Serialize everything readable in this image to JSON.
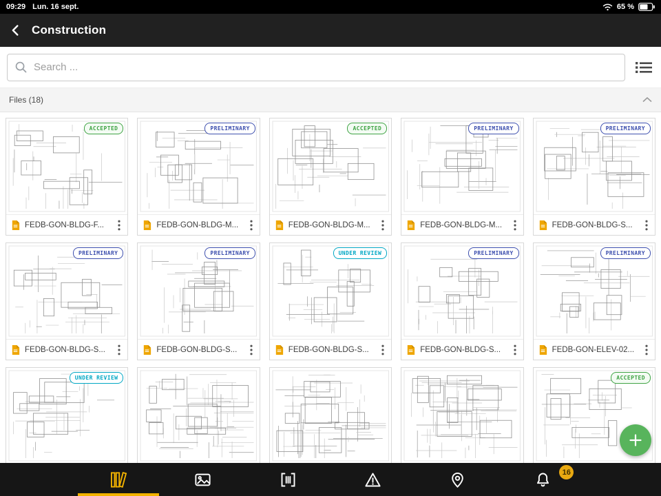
{
  "status_bar": {
    "time": "09:29",
    "date": "Lun. 16 sept.",
    "battery_percent": "65 %"
  },
  "header": {
    "title": "Construction"
  },
  "search": {
    "placeholder": "Search ..."
  },
  "files_section": {
    "title": "Files (18)"
  },
  "colors": {
    "accent": "#f2b200",
    "fab": "#58b45c",
    "accepted": "#3fa344",
    "preliminary": "#3d4fae",
    "under_review": "#00a7c4"
  },
  "statuses": {
    "ACCEPTED": {
      "color": "#3fa344",
      "bg": "#f3fbf3"
    },
    "PRELIMINARY": {
      "color": "#3d4fae",
      "bg": "#ffffff"
    },
    "UNDER REVIEW": {
      "color": "#00a7c4",
      "bg": "#ffffff"
    }
  },
  "files": [
    {
      "name": "FEDB-GON-BLDG-F...",
      "status": "ACCEPTED"
    },
    {
      "name": "FEDB-GON-BLDG-M...",
      "status": "PRELIMINARY"
    },
    {
      "name": "FEDB-GON-BLDG-M...",
      "status": "ACCEPTED"
    },
    {
      "name": "FEDB-GON-BLDG-M...",
      "status": "PRELIMINARY"
    },
    {
      "name": "FEDB-GON-BLDG-S...",
      "status": "PRELIMINARY"
    },
    {
      "name": "FEDB-GON-BLDG-S...",
      "status": "PRELIMINARY"
    },
    {
      "name": "FEDB-GON-BLDG-S...",
      "status": "PRELIMINARY"
    },
    {
      "name": "FEDB-GON-BLDG-S...",
      "status": "UNDER REVIEW"
    },
    {
      "name": "FEDB-GON-BLDG-S...",
      "status": "PRELIMINARY"
    },
    {
      "name": "FEDB-GON-ELEV-02...",
      "status": "PRELIMINARY"
    },
    {
      "name": "",
      "status": "UNDER REVIEW"
    },
    {
      "name": "",
      "status": null
    },
    {
      "name": "",
      "status": null
    },
    {
      "name": "",
      "status": null
    },
    {
      "name": "",
      "status": "ACCEPTED"
    }
  ],
  "fab": {
    "icon": "plus"
  },
  "tab_bar": {
    "active_tab": "plans",
    "notification_count": "16",
    "tabs": [
      "plans",
      "photos",
      "barcode-scan",
      "issues",
      "locations",
      "notifications"
    ]
  },
  "icons": {
    "back": "chevron-left",
    "search": "magnifier",
    "view_toggle": "bullet-list",
    "collapse": "chevron-up",
    "file": "document",
    "card_menu": "kebab-vertical",
    "status_bar": [
      "wifi",
      "battery"
    ]
  }
}
